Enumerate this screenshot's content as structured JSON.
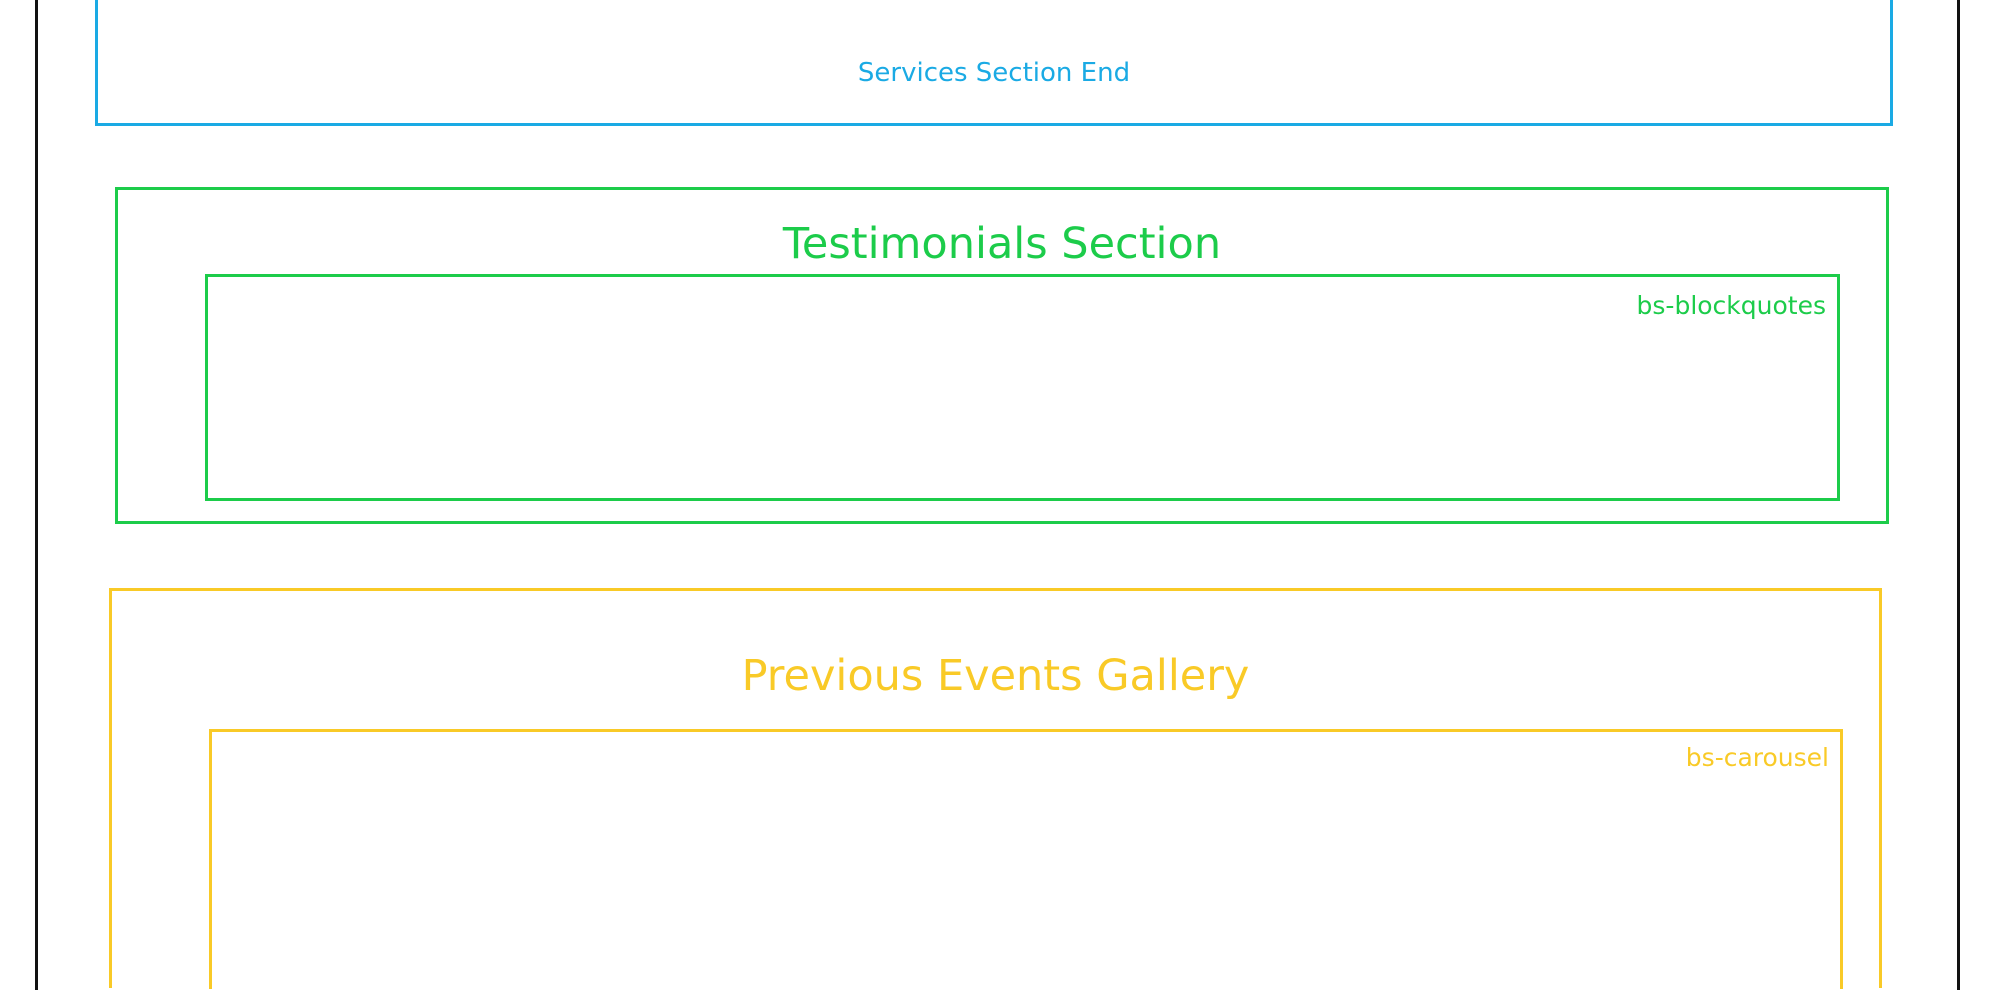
{
  "services": {
    "end_label": "Services Section End",
    "color": "#1aaae4"
  },
  "testimonials": {
    "title": "Testimonials Section",
    "component": "bs-blockquotes",
    "color": "#1ccc4a"
  },
  "gallery": {
    "title": "Previous Events Gallery",
    "component": "bs-carousel",
    "color": "#f9ca27"
  },
  "frame_color": "#111111"
}
